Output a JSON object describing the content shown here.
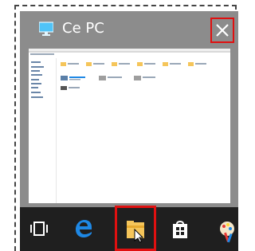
{
  "window": {
    "title": "Ce PC",
    "icon": "computer-icon",
    "close_icon": "close-icon"
  },
  "taskbar": {
    "items": [
      {
        "name": "task-view",
        "icon": "task-view-icon"
      },
      {
        "name": "edge",
        "icon": "edge-icon"
      },
      {
        "name": "file-explorer",
        "icon": "folder-icon",
        "highlighted": true
      },
      {
        "name": "store",
        "icon": "store-icon"
      },
      {
        "name": "paint",
        "icon": "paint-icon"
      }
    ]
  },
  "colors": {
    "highlight": "#e01010",
    "taskbar": "#1f1f1f",
    "panel": "#8c8c8c",
    "accent": "#1e88e5"
  }
}
